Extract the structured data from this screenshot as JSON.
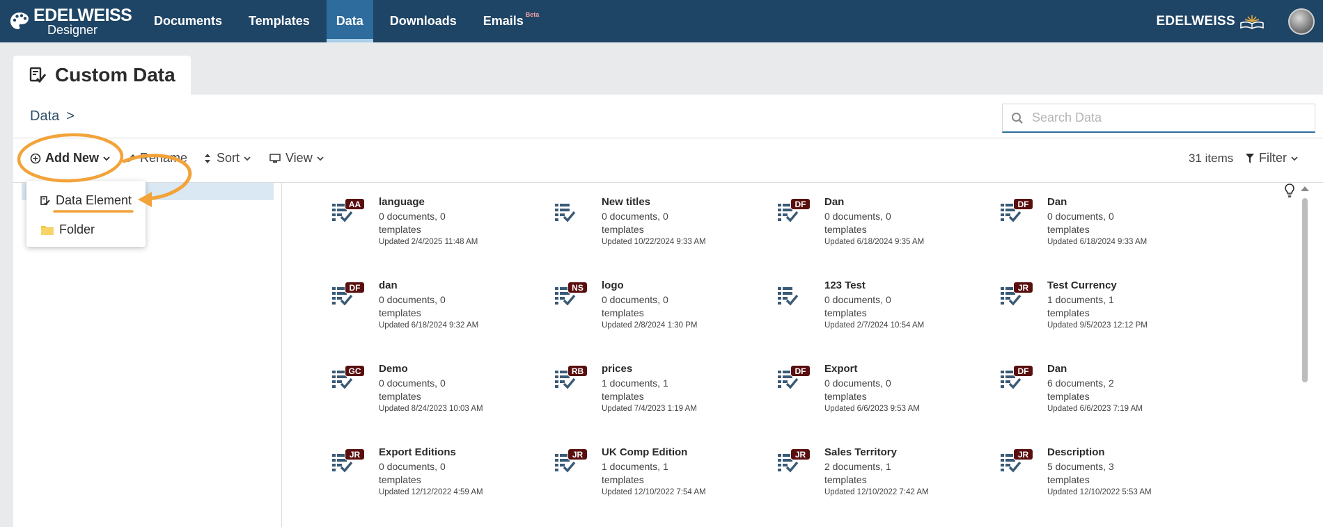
{
  "brand": {
    "name": "EDELWEISS",
    "sub": "Designer",
    "wordmark": "EDELWEISS"
  },
  "nav": [
    {
      "label": "Documents",
      "active": false
    },
    {
      "label": "Templates",
      "active": false
    },
    {
      "label": "Data",
      "active": true
    },
    {
      "label": "Downloads",
      "active": false
    },
    {
      "label": "Emails",
      "badge": "Beta",
      "active": false
    }
  ],
  "page": {
    "title": "Custom Data"
  },
  "breadcrumb": {
    "root": "Data",
    "sep": ">"
  },
  "search": {
    "placeholder": "Search Data",
    "value": ""
  },
  "toolbar": {
    "add_new": "Add New",
    "rename": "Rename",
    "sort": "Sort",
    "view": "View",
    "items_count": "31 items",
    "filter": "Filter"
  },
  "dropdown": {
    "data_element": "Data Element",
    "folder": "Folder"
  },
  "colors": {
    "nav_bg": "#1f4566",
    "nav_active": "#2d6c9c",
    "badge_bg": "#5a0f0f",
    "annotation": "#f2a33a",
    "icon": "#3a5a76"
  },
  "items": [
    {
      "badge": "AA",
      "name": "language",
      "meta1": "0 documents, 0",
      "meta2": "templates",
      "updated": "Updated 2/4/2025 11:48 AM"
    },
    {
      "badge": "",
      "name": "New titles",
      "meta1": "0 documents, 0",
      "meta2": "templates",
      "updated": "Updated 10/22/2024 9:33 AM"
    },
    {
      "badge": "DF",
      "name": "Dan",
      "meta1": "0 documents, 0",
      "meta2": "templates",
      "updated": "Updated 6/18/2024 9:35 AM"
    },
    {
      "badge": "DF",
      "name": "Dan",
      "meta1": "0 documents, 0",
      "meta2": "templates",
      "updated": "Updated 6/18/2024 9:33 AM"
    },
    {
      "badge": "DF",
      "name": "dan",
      "meta1": "0 documents, 0",
      "meta2": "templates",
      "updated": "Updated 6/18/2024 9:32 AM"
    },
    {
      "badge": "NS",
      "name": "logo",
      "meta1": "0 documents, 0",
      "meta2": "templates",
      "updated": "Updated 2/8/2024 1:30 PM"
    },
    {
      "badge": "",
      "name": "123 Test",
      "meta1": "0 documents, 0",
      "meta2": "templates",
      "updated": "Updated 2/7/2024 10:54 AM"
    },
    {
      "badge": "JR",
      "name": "Test Currency",
      "meta1": "1 documents, 1",
      "meta2": "templates",
      "updated": "Updated 9/5/2023 12:12 PM"
    },
    {
      "badge": "GC",
      "name": "Demo",
      "meta1": "0 documents, 0",
      "meta2": "templates",
      "updated": "Updated 8/24/2023 10:03 AM"
    },
    {
      "badge": "RB",
      "name": "prices",
      "meta1": "1 documents, 1",
      "meta2": "templates",
      "updated": "Updated 7/4/2023 1:19 AM"
    },
    {
      "badge": "DF",
      "name": "Export",
      "meta1": "0 documents, 0",
      "meta2": "templates",
      "updated": "Updated 6/6/2023 9:53 AM"
    },
    {
      "badge": "DF",
      "name": "Dan",
      "meta1": "6 documents, 2",
      "meta2": "templates",
      "updated": "Updated 6/6/2023 7:19 AM"
    },
    {
      "badge": "JR",
      "name": "Export Editions",
      "meta1": "0 documents, 0",
      "meta2": "templates",
      "updated": "Updated 12/12/2022 4:59 AM"
    },
    {
      "badge": "JR",
      "name": "UK Comp Edition",
      "meta1": "1 documents, 1",
      "meta2": "templates",
      "updated": "Updated 12/10/2022 7:54 AM"
    },
    {
      "badge": "JR",
      "name": "Sales Territory",
      "meta1": "2 documents, 1",
      "meta2": "templates",
      "updated": "Updated 12/10/2022 7:42 AM"
    },
    {
      "badge": "JR",
      "name": "Description",
      "meta1": "5 documents, 3",
      "meta2": "templates",
      "updated": "Updated 12/10/2022 5:53 AM"
    }
  ]
}
